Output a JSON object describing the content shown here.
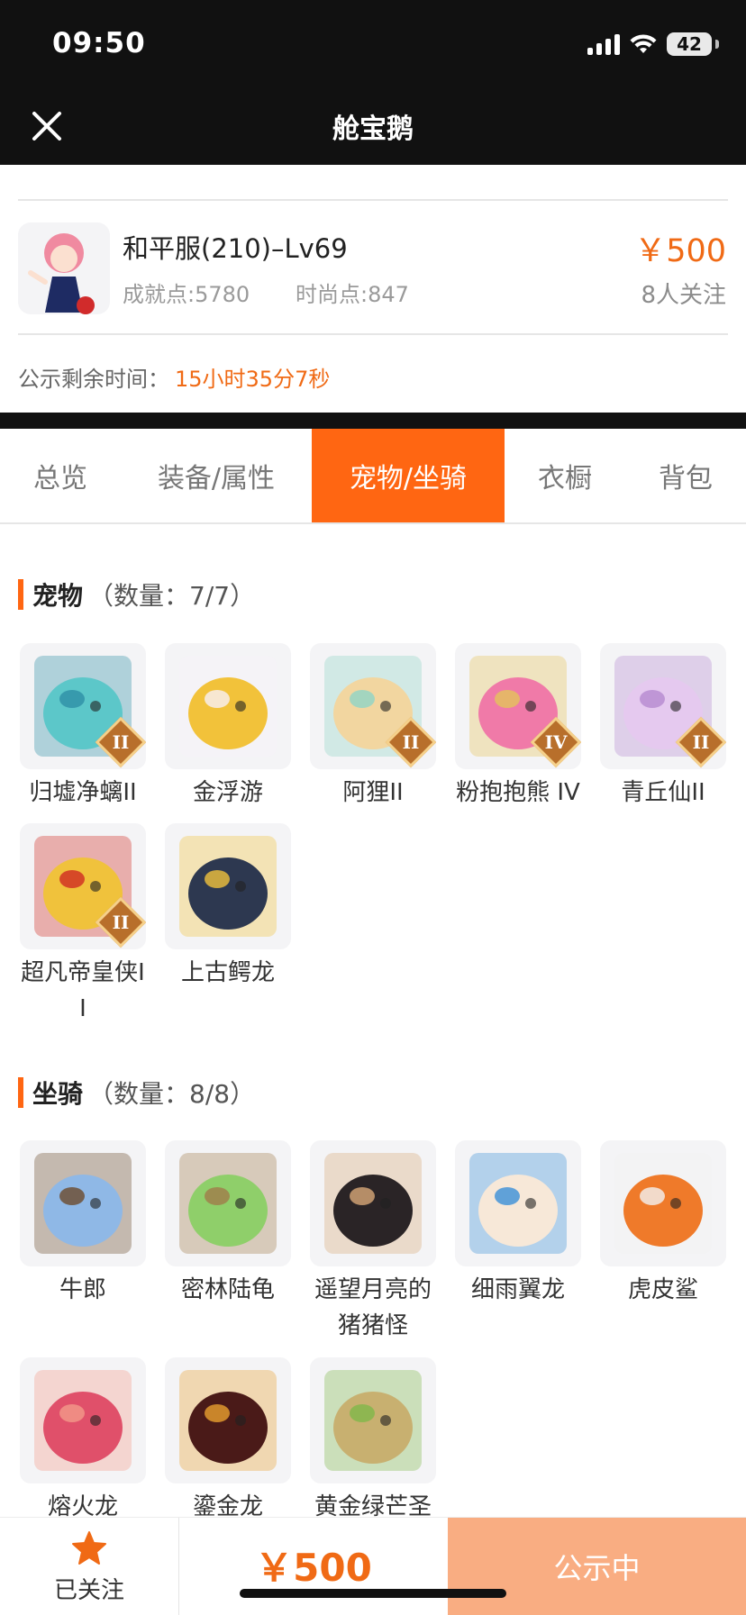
{
  "status_bar": {
    "time": "09:50",
    "battery": "42"
  },
  "nav": {
    "title": "舱宝鹅",
    "close_icon": "close-icon"
  },
  "account": {
    "title": "和平服(210)–Lv69",
    "achievement": "成就点:5780",
    "fashion": "时尚点:847",
    "price": "￥500",
    "followers": "8人关注",
    "public_label": "公示剩余时间：",
    "public_time": "15小时35分7秒"
  },
  "tabs": [
    {
      "label": "总览",
      "active": false
    },
    {
      "label": "装备/属性",
      "active": false
    },
    {
      "label": "宠物/坐骑",
      "active": true
    },
    {
      "label": "衣橱",
      "active": false
    },
    {
      "label": "背包",
      "active": false
    }
  ],
  "pets": {
    "title": "宠物",
    "count": "（数量：7/7）",
    "items": [
      {
        "name": "归墟净螭II",
        "badge": "II",
        "colors": [
          "#5cc7c9",
          "#2e8fa6"
        ]
      },
      {
        "name": "金浮游",
        "badge": "",
        "colors": [
          "#f2c23a",
          "#f7f0f8"
        ]
      },
      {
        "name": "阿狸II",
        "badge": "II",
        "colors": [
          "#f2d6a0",
          "#8fd4c7"
        ]
      },
      {
        "name": "粉抱抱熊 IV",
        "badge": "IV",
        "colors": [
          "#f07aa8",
          "#e4c45a"
        ]
      },
      {
        "name": "青丘仙II",
        "badge": "II",
        "colors": [
          "#e5c9ef",
          "#b58ad0"
        ]
      },
      {
        "name": "超凡帝皇侠II",
        "badge": "II",
        "colors": [
          "#f0c23c",
          "#d02a22"
        ]
      },
      {
        "name": "上古鳄龙",
        "badge": "",
        "colors": [
          "#2d3850",
          "#f0c23c"
        ]
      }
    ]
  },
  "mounts": {
    "title": "坐骑",
    "count": "（数量：8/8）",
    "items": [
      {
        "name": "牛郎",
        "colors": [
          "#8fb8e6",
          "#6b4a2c"
        ]
      },
      {
        "name": "密林陆龟",
        "colors": [
          "#8fcf6a",
          "#a07a4a"
        ]
      },
      {
        "name": "遥望月亮的猪猪怪",
        "colors": [
          "#2a2426",
          "#d8a878"
        ]
      },
      {
        "name": "细雨翼龙",
        "colors": [
          "#f7e8d8",
          "#3a8fd8"
        ]
      },
      {
        "name": "虎皮鲨",
        "colors": [
          "#ef7a2a",
          "#f2f2f2"
        ]
      },
      {
        "name": "熔火龙",
        "colors": [
          "#e0506a",
          "#f39a8a"
        ]
      },
      {
        "name": "鎏金龙",
        "colors": [
          "#4a1a18",
          "#e9a030"
        ]
      },
      {
        "name": "黄金绿芒圣",
        "colors": [
          "#c8b070",
          "#7fb84a"
        ]
      }
    ]
  },
  "bottom": {
    "follow_label": "已关注",
    "price": "￥500",
    "status_button": "公示中"
  },
  "colors": {
    "accent": "#ff6612",
    "price": "#f06a15",
    "button_disabled": "#f9ad82",
    "header": "#111111"
  }
}
